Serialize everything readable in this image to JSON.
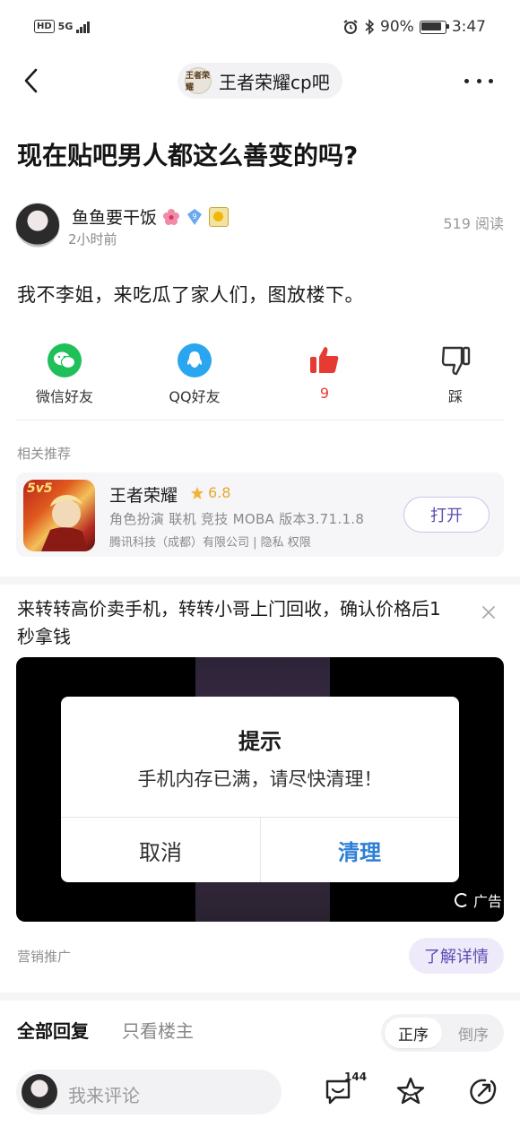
{
  "status_bar": {
    "left_hd": "HD",
    "left_net": "5G",
    "battery": "90%",
    "time": "3:47"
  },
  "header": {
    "forum_logo_text": "王者荣耀",
    "forum_name": "王者荣耀cp吧"
  },
  "post": {
    "title": "现在贴吧男人都这么善变的吗?",
    "author": "鱼鱼要干饭",
    "level": "9",
    "time": "2小时前",
    "views": "519 阅读",
    "content": "我不李姐，来吃瓜了家人们，图放楼下。"
  },
  "share": {
    "wechat": "微信好友",
    "qq": "QQ好友",
    "likes": "9",
    "dislike": "踩"
  },
  "related": {
    "label": "相关推荐",
    "app": {
      "icon_text": "5v5",
      "name": "王者荣耀",
      "rating": "6.8",
      "meta": "角色扮演 联机 竞技 MOBA  版本3.71.1.8",
      "developer": "腾讯科技（成都）有限公司 | 隐私 权限",
      "open_label": "打开"
    }
  },
  "ad": {
    "title": "来转转高价卖手机，转转小哥上门回收，确认价格后1秒拿钱",
    "dialog_title": "提示",
    "dialog_message": "手机内存已满，请尽快清理！",
    "dialog_cancel": "取消",
    "dialog_confirm": "清理",
    "ad_badge": "广告",
    "promo_label": "营销推广",
    "detail_button": "了解详情"
  },
  "replies": {
    "tab_all": "全部回复",
    "tab_op": "只看楼主",
    "order_asc": "正序",
    "order_desc": "倒序"
  },
  "bottom": {
    "comment_placeholder": "我来评论",
    "comment_count": "144"
  },
  "colors": {
    "wechat_green": "#1fbf5a",
    "qq_blue": "#2aa6f0",
    "like_red": "#e53b32",
    "accent_purple": "#5a4db4",
    "confirm_blue": "#2f7fd6"
  }
}
